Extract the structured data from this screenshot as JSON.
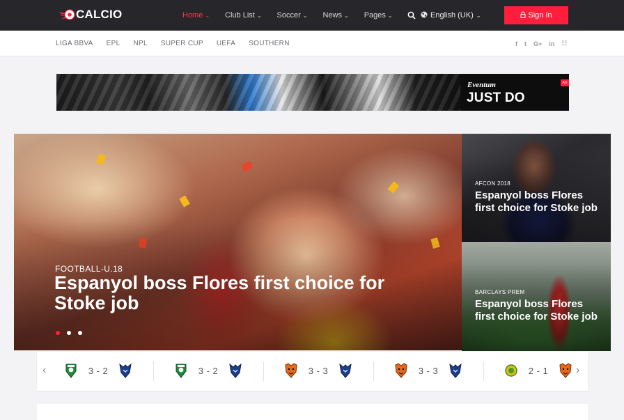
{
  "brand": {
    "name": "CALCIO",
    "accent": "#ff1e3c",
    "logo_icon": "flaming-football-icon"
  },
  "nav": {
    "items": [
      {
        "label": "Home",
        "active": true
      },
      {
        "label": "Club List",
        "active": false
      },
      {
        "label": "Soccer",
        "active": false
      },
      {
        "label": "News",
        "active": false
      },
      {
        "label": "Pages",
        "active": false
      }
    ],
    "language": "English (UK)",
    "signin_label": "Sign In"
  },
  "subnav": {
    "leagues": [
      "LIGA BBVA",
      "EPL",
      "NPL",
      "SUPER CUP",
      "UEFA",
      "SOUTHERN"
    ],
    "social": [
      {
        "icon": "facebook-icon",
        "glyph": "f"
      },
      {
        "icon": "twitter-icon",
        "glyph": "t"
      },
      {
        "icon": "google-plus-icon",
        "glyph": "G+"
      },
      {
        "icon": "linkedin-icon",
        "glyph": "in"
      },
      {
        "icon": "rss-icon",
        "glyph": "☷"
      }
    ]
  },
  "ad": {
    "brand": "Eventum",
    "slogan": "JUST DO",
    "tag": "AD"
  },
  "hero": {
    "category": "FOOTBALL-U.18",
    "title": "Espanyol boss Flores first choice for Stoke job",
    "slides": 3,
    "active_slide": 1
  },
  "side_cards": [
    {
      "category": "AFCON 2018",
      "title": "Espanyol boss Flores first choice for Stoke job"
    },
    {
      "category": "BARCLAYS PREM",
      "title": "Espanyol boss Flores first choice for Stoke job"
    }
  ],
  "matches": [
    {
      "home_crest": "green-shield-crest-icon",
      "score": "3 - 2",
      "away_crest": "blue-wolf-crest-icon"
    },
    {
      "home_crest": "green-shield-crest-icon",
      "score": "3 - 2",
      "away_crest": "blue-wolf-crest-icon"
    },
    {
      "home_crest": "tiger-crest-icon",
      "score": "3 - 3",
      "away_crest": "blue-wolf-crest-icon"
    },
    {
      "home_crest": "tiger-crest-icon",
      "score": "3 - 3",
      "away_crest": "blue-wolf-crest-icon"
    },
    {
      "home_crest": "yellow-green-crest-icon",
      "score": "2 - 1",
      "away_crest": "tiger-crest-icon"
    }
  ]
}
